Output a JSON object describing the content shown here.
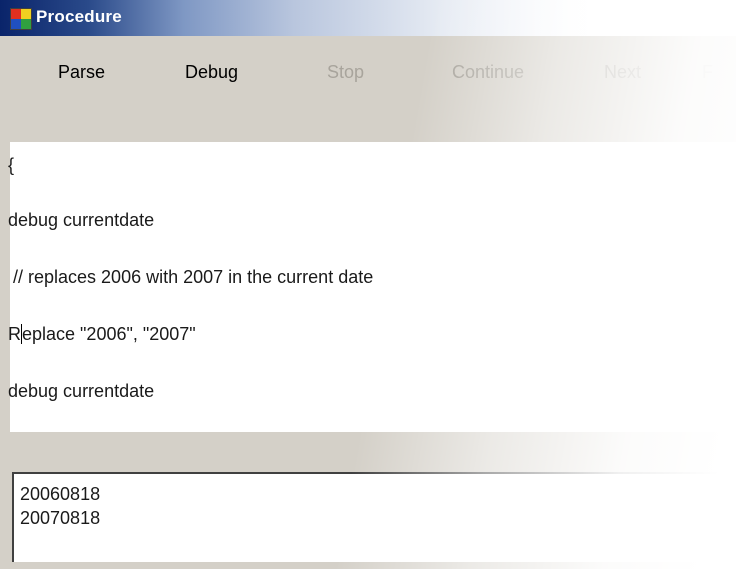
{
  "window": {
    "title": "Procedure",
    "icon": "app-icon"
  },
  "toolbar": {
    "parse_label": "Parse",
    "debug_label": "Debug",
    "stop_label": "Stop",
    "continue_label": "Continue",
    "next_label": "Next",
    "cut_label": "F"
  },
  "editor": {
    "lines": [
      "{",
      "debug currentdate",
      " // replaces 2006 with 2007 in the current date",
      "R",
      "eplace \"2006\", \"2007\"",
      "debug currentdate"
    ]
  },
  "output": {
    "lines": [
      "20060818",
      "20070818"
    ]
  },
  "colors": {
    "title_bar": "#0a246a",
    "face": "#d4d0c8",
    "disabled_text": "#a8a49c"
  }
}
